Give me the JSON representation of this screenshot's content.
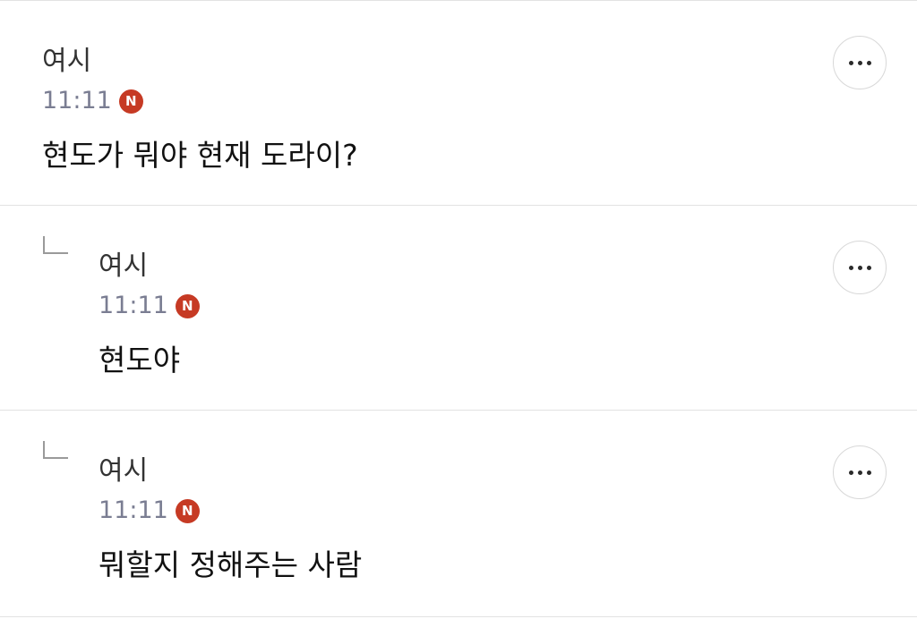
{
  "comments": [
    {
      "author": "여시",
      "time": "11:11",
      "badge": "N",
      "text": "현도가 뭐야 현재 도라이?",
      "is_reply": false
    },
    {
      "author": "여시",
      "time": "11:11",
      "badge": "N",
      "text": "현도야",
      "is_reply": true
    },
    {
      "author": "여시",
      "time": "11:11",
      "badge": "N",
      "text": "뭐할지 정해주는 사람",
      "is_reply": true
    }
  ],
  "icons": {
    "more": "more-horizontal-icon",
    "reply": "reply-arrow-icon",
    "new": "new-badge-icon"
  },
  "colors": {
    "badge": "#c63a24",
    "time": "#7a7d92",
    "divider": "#e2e2e2"
  }
}
